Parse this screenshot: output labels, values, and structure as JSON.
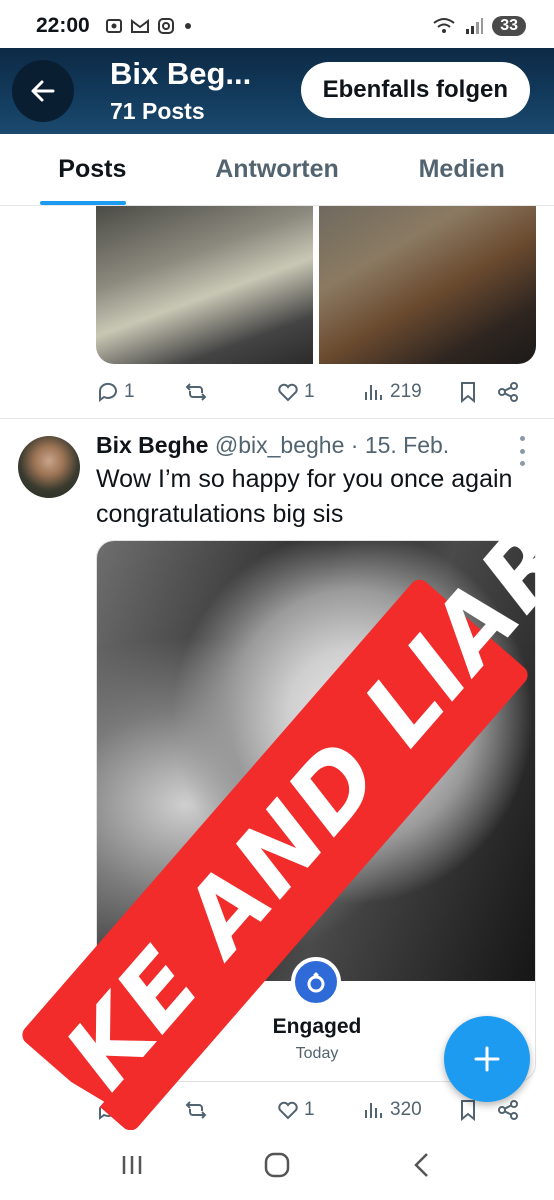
{
  "status_bar": {
    "time": "22:00",
    "left_icons": [
      "screenshot-icon",
      "gmail-icon",
      "instagram-icon",
      "dot-icon"
    ],
    "right_icons": [
      "wifi-icon",
      "signal-icon"
    ],
    "battery": "33"
  },
  "header": {
    "title": "Bix Beg...",
    "subtitle": "71 Posts",
    "follow_label": "Ebenfalls folgen"
  },
  "tabs": [
    {
      "label": "Posts",
      "active": true
    },
    {
      "label": "Antworten",
      "active": false
    },
    {
      "label": "Medien",
      "active": false
    }
  ],
  "post1_actions": {
    "replies": "1",
    "retweets": "",
    "likes": "1",
    "views": "219"
  },
  "post2": {
    "author": "Bix Beghe",
    "handle": "@bix_beghe",
    "date": "· 15. Feb.",
    "text": "Wow I’m so happy for you once again congratulations big sis",
    "card_title": "Engaged",
    "card_subtitle": "Today",
    "actions": {
      "replies": "",
      "retweets": "",
      "likes": "1",
      "views": "320"
    }
  },
  "overlay_stamp": "FAKE AND LIAR",
  "colors": {
    "accent": "#1d9bf0",
    "header_bg": "#123a5c",
    "stamp": "#f22b2b"
  }
}
